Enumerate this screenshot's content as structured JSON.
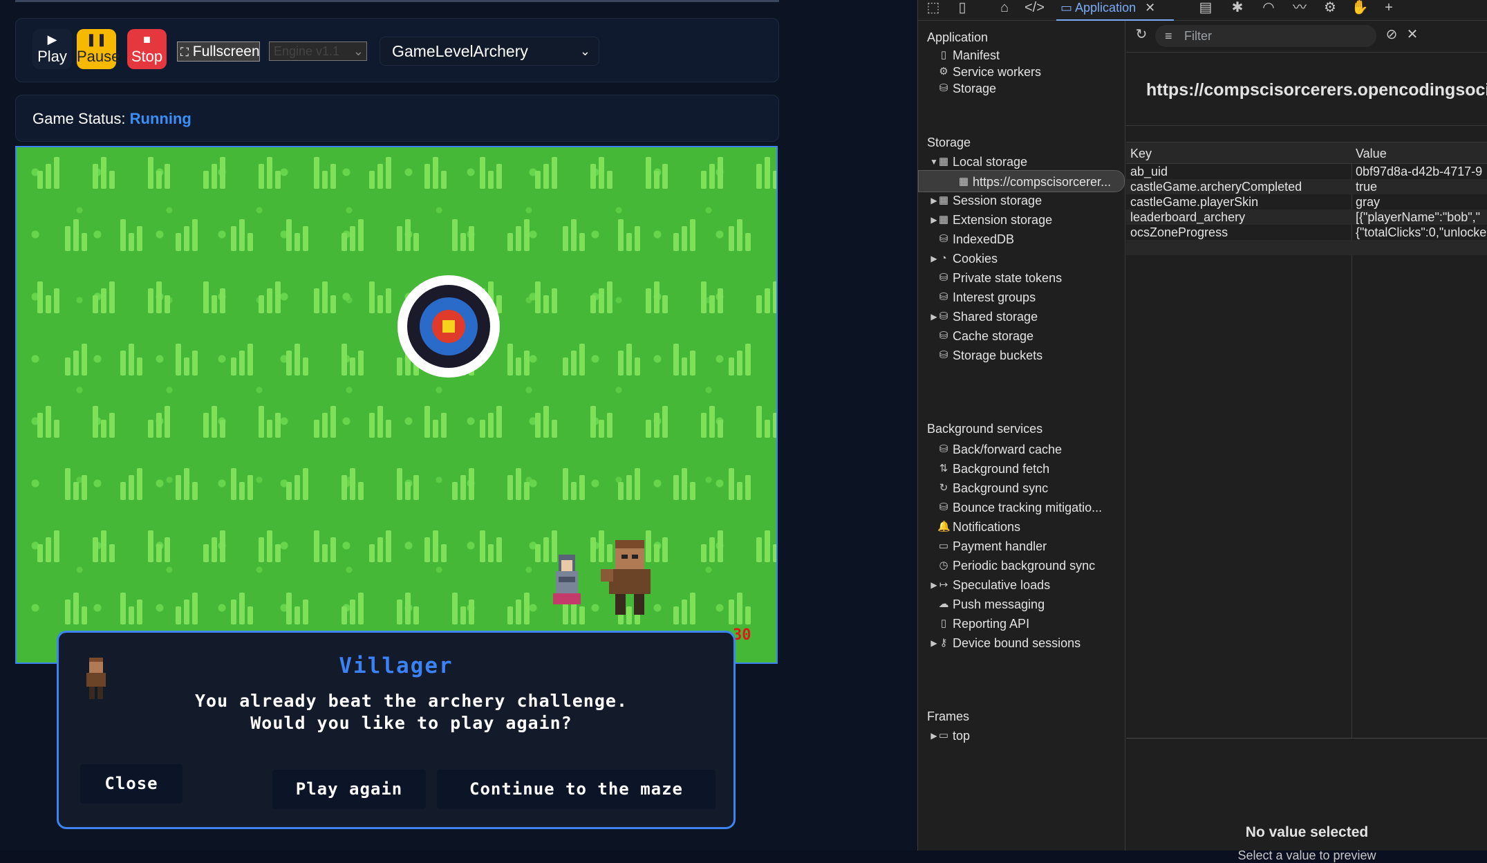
{
  "toolbar": {
    "play_label": "Play",
    "pause_label": "Pause",
    "stop_label": "Stop",
    "fullscreen_label": "Fullscreen",
    "engine_select_value": "Engine v1.1",
    "level_select_value": "GameLevelArchery"
  },
  "status": {
    "label": "Game Status:",
    "value": "Running"
  },
  "game": {
    "score": "30"
  },
  "dialog": {
    "speaker": "Villager",
    "line1": "You already beat the archery challenge.",
    "line2": "Would you like to play again?",
    "close_label": "Close",
    "play_again_label": "Play again",
    "continue_label": "Continue to the maze"
  },
  "devtools": {
    "active_tab": "Application",
    "sidebar": {
      "application_header": "Application",
      "application_items": [
        "Manifest",
        "Service workers",
        "Storage"
      ],
      "storage_header": "Storage",
      "storage_items": [
        "Local storage",
        "https://compscisorcerer...",
        "Session storage",
        "Extension storage",
        "IndexedDB",
        "Cookies",
        "Private state tokens",
        "Interest groups",
        "Shared storage",
        "Cache storage",
        "Storage buckets"
      ],
      "background_header": "Background services",
      "background_items": [
        "Back/forward cache",
        "Background fetch",
        "Background sync",
        "Bounce tracking mitigatio...",
        "Notifications",
        "Payment handler",
        "Periodic background sync",
        "Speculative loads",
        "Push messaging",
        "Reporting API",
        "Device bound sessions"
      ],
      "frames_header": "Frames",
      "frames_items": [
        "top"
      ]
    },
    "filter_placeholder": "Filter",
    "origin": "https://compscisorcerers.opencodingsociety.c",
    "table": {
      "headers": [
        "Key",
        "Value"
      ],
      "rows": [
        [
          "ab_uid",
          "0bf97d8a-d42b-4717-9"
        ],
        [
          "castleGame.archeryCompleted",
          "true"
        ],
        [
          "castleGame.playerSkin",
          "gray"
        ],
        [
          "leaderboard_archery",
          "[{\"playerName\":\"bob\",\""
        ],
        [
          "ocsZoneProgress",
          "{\"totalClicks\":0,\"unlocke"
        ]
      ]
    },
    "preview_title": "No value selected",
    "preview_sub": "Select a value to preview"
  }
}
